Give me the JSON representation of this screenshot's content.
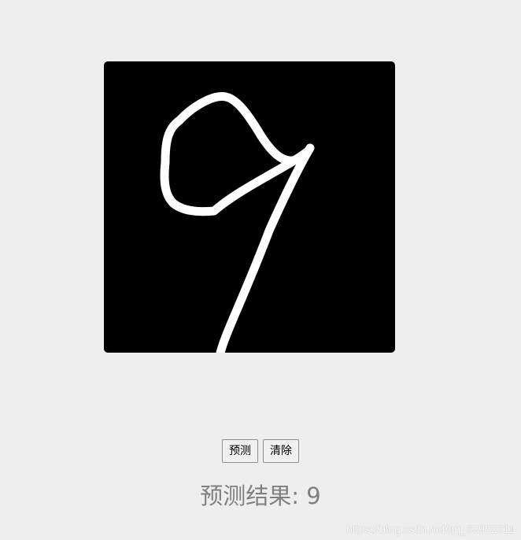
{
  "canvas": {
    "background_color": "#000000",
    "stroke_color": "#ffffff",
    "drawn_digit": "9"
  },
  "toolbar": {
    "predict_label": "预测",
    "clear_label": "清除"
  },
  "result": {
    "label": "预测结果: ",
    "value": "9",
    "text_color": "#808080"
  },
  "watermark": {
    "text": "https://blog.csdn.net/qq_33952811"
  }
}
